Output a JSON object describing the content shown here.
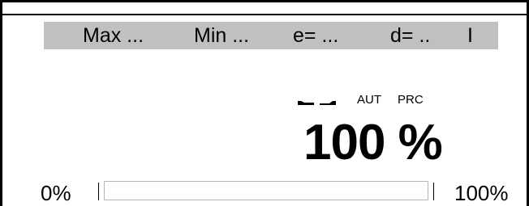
{
  "header": {
    "max_label": "Max ...",
    "min_label": "Min ...",
    "e_label": "e= ...",
    "d_label": "d= ..",
    "bar_label": "I"
  },
  "indicators": {
    "icon1": "stable-indicator-left",
    "icon2": "stable-indicator-right",
    "aut": "AUT",
    "prc": "PRC"
  },
  "reading": {
    "value": "100 %"
  },
  "progress": {
    "min_label": "0%",
    "max_label": "100%",
    "percent": 100
  },
  "colors": {
    "header_bg": "#c0c0c0",
    "text": "#000000",
    "background": "#ffffff"
  }
}
